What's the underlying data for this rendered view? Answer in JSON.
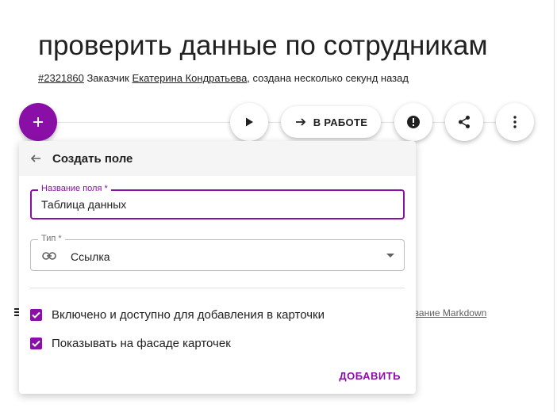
{
  "task": {
    "title": "проверить данные по сотрудникам",
    "id": "#2321860",
    "customer_label": " Заказчик ",
    "customer_name": "Екатерина Кондратьева",
    "created": ", создана несколько секунд назад"
  },
  "toolbar": {
    "status_label": "В РАБОТЕ"
  },
  "background": {
    "markdown_link": "ование Markdown"
  },
  "card": {
    "header_title": "Создать поле",
    "name_field": {
      "label": "Название поля *",
      "value": "Таблица данных"
    },
    "type_field": {
      "label": "Тип *",
      "value": "Ссылка"
    },
    "checkbox_enabled": {
      "label": "Включено и доступно для добавления в карточки",
      "checked": true
    },
    "checkbox_facade": {
      "label": "Показывать на фасаде карточек",
      "checked": true
    },
    "add_label": "ДОБАВИТЬ"
  },
  "colors": {
    "accent": "#8a0fa6",
    "header_bg": "#f5f5f5",
    "border": "#bdbdbd"
  },
  "icons": [
    "plus-icon",
    "play-icon",
    "arrow-right-icon",
    "alert-icon",
    "share-icon",
    "more-vert-icon",
    "arrow-back-icon",
    "link-icon",
    "chevron-down-icon",
    "check-icon",
    "list-icon"
  ]
}
